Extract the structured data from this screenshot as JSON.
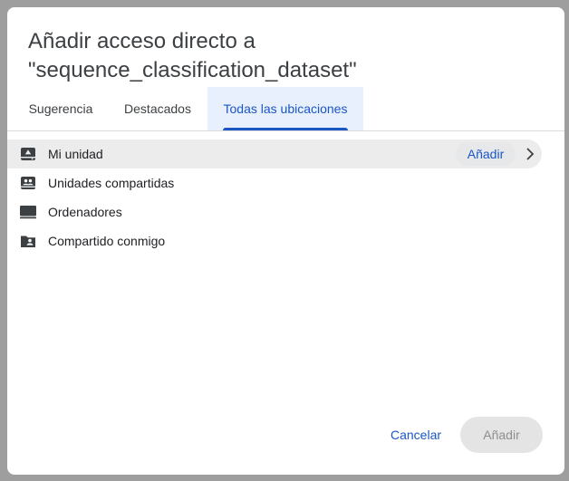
{
  "dialog": {
    "title_line1": "Añadir acceso directo a",
    "title_line2": "\"sequence_classification_dataset\""
  },
  "tabs": [
    {
      "label": "Sugerencia",
      "active": false
    },
    {
      "label": "Destacados",
      "active": false
    },
    {
      "label": "Todas las ubicaciones",
      "active": true
    }
  ],
  "locations": [
    {
      "label": "Mi unidad",
      "icon": "my-drive-icon",
      "selected": true
    },
    {
      "label": "Unidades compartidas",
      "icon": "shared-drives-icon",
      "selected": false
    },
    {
      "label": "Ordenadores",
      "icon": "computers-icon",
      "selected": false
    },
    {
      "label": "Compartido conmigo",
      "icon": "shared-with-me-icon",
      "selected": false
    }
  ],
  "row_actions": {
    "add_label": "Añadir"
  },
  "footer": {
    "cancel_label": "Cancelar",
    "add_label": "Añadir"
  },
  "colors": {
    "accent": "#1a56c4",
    "active_tab_bg": "#e8f0fe",
    "selected_row_bg": "#ececec",
    "disabled_button_bg": "#e4e4e4"
  }
}
